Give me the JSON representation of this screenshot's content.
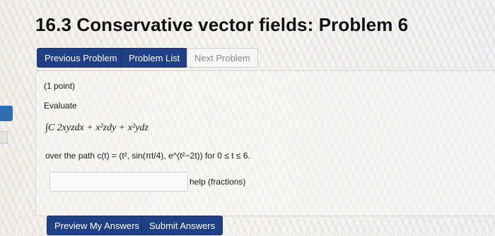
{
  "page": {
    "title": "16.3 Conservative vector fields: Problem 6"
  },
  "nav": {
    "previous": "Previous Problem",
    "list": "Problem List",
    "next": "Next Problem"
  },
  "problem": {
    "points": "(1 point)",
    "instruction": "Evaluate",
    "integral": "∫C 2xyzdx + x²zdy + x²ydz",
    "path_text": "over the path c(t) = (t², sin(πt/4), e^(t²−2t)) for 0 ≤ t ≤ 6.",
    "answer_value": "",
    "help_text": "help (fractions)"
  },
  "actions": {
    "preview": "Preview My Answers",
    "submit": "Submit Answers"
  },
  "colors": {
    "primary": "#1f3f86",
    "side_tab": "#2e6fb3"
  }
}
